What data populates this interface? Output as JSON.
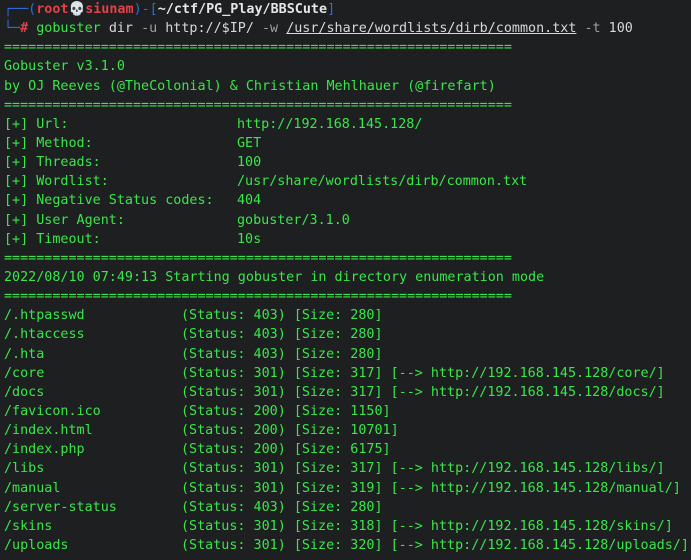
{
  "prompt": {
    "frame_top": "┌──(",
    "user": "root",
    "skull": "💀",
    "host": "siunam",
    "frame_mid": ")-[",
    "path": "~/ctf/PG_Play/BBSCute",
    "frame_end": "]",
    "frame_bottom": "└─",
    "symbol": "#"
  },
  "command": {
    "bin": "gobuster",
    "sub": "dir",
    "flag_u": "-u",
    "url": "http://$IP/",
    "flag_w": "-w",
    "wordlist": "/usr/share/wordlists/dirb/common.txt",
    "flag_t": "-t",
    "threads": "100"
  },
  "separator": "===============================================================",
  "header": {
    "version": "Gobuster v3.1.0",
    "authors": "by OJ Reeves (@TheColonial) & Christian Mehlhauer (@firefart)"
  },
  "config": [
    {
      "label": "[+] Url:",
      "value": "http://192.168.145.128/"
    },
    {
      "label": "[+] Method:",
      "value": "GET"
    },
    {
      "label": "[+] Threads:",
      "value": "100"
    },
    {
      "label": "[+] Wordlist:",
      "value": "/usr/share/wordlists/dirb/common.txt"
    },
    {
      "label": "[+] Negative Status codes:",
      "value": "404"
    },
    {
      "label": "[+] User Agent:",
      "value": "gobuster/3.1.0"
    },
    {
      "label": "[+] Timeout:",
      "value": "10s"
    }
  ],
  "start_message": "2022/08/10 07:49:13 Starting gobuster in directory enumeration mode",
  "results": [
    {
      "path": "/.htpasswd",
      "info": "(Status: 403) [Size: 280]"
    },
    {
      "path": "/.htaccess",
      "info": "(Status: 403) [Size: 280]"
    },
    {
      "path": "/.hta",
      "info": "(Status: 403) [Size: 280]"
    },
    {
      "path": "/core",
      "info": "(Status: 301) [Size: 317] [--> http://192.168.145.128/core/]"
    },
    {
      "path": "/docs",
      "info": "(Status: 301) [Size: 317] [--> http://192.168.145.128/docs/]"
    },
    {
      "path": "/favicon.ico",
      "info": "(Status: 200) [Size: 1150]"
    },
    {
      "path": "/index.html",
      "info": "(Status: 200) [Size: 10701]"
    },
    {
      "path": "/index.php",
      "info": "(Status: 200) [Size: 6175]"
    },
    {
      "path": "/libs",
      "info": "(Status: 301) [Size: 317] [--> http://192.168.145.128/libs/]"
    },
    {
      "path": "/manual",
      "info": "(Status: 301) [Size: 319] [--> http://192.168.145.128/manual/]"
    },
    {
      "path": "/server-status",
      "info": "(Status: 403) [Size: 280]"
    },
    {
      "path": "/skins",
      "info": "(Status: 301) [Size: 318] [--> http://192.168.145.128/skins/]"
    },
    {
      "path": "/uploads",
      "info": "(Status: 301) [Size: 320] [--> http://192.168.145.128/uploads/]"
    }
  ]
}
